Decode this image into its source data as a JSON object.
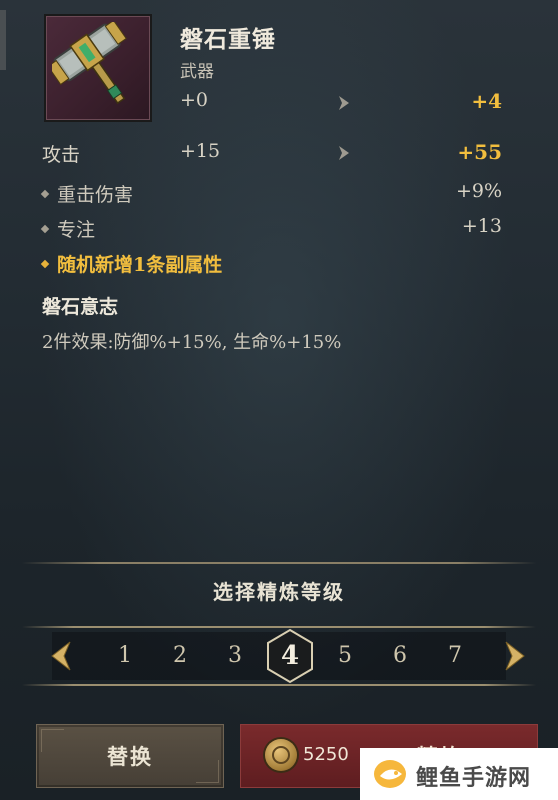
{
  "item": {
    "name": "磐石重锤",
    "type": "武器",
    "icon": "hammer-icon"
  },
  "enhance": {
    "current": "+0",
    "next": "+4"
  },
  "stats": {
    "attack": {
      "label": "攻击",
      "current": "+15",
      "next": "+55"
    },
    "substats": [
      {
        "label": "重击伤害",
        "value": "+9%"
      },
      {
        "label": "专注",
        "value": "+13"
      }
    ],
    "random_note": "随机新增1条副属性"
  },
  "set": {
    "name": "磐石意志",
    "effect": "2件效果:防御%+15%, 生命%+15%"
  },
  "refine": {
    "title": "选择精炼等级",
    "levels": [
      "1",
      "2",
      "3",
      "4",
      "5",
      "6",
      "7"
    ],
    "selected": "4"
  },
  "buttons": {
    "replace": "替换",
    "refine_cost": "5250",
    "refine": "精炼"
  },
  "watermark": {
    "text": "鲤鱼手游网"
  },
  "colors": {
    "gold": "#f2be3e",
    "refine_button": "#7a2a2c"
  }
}
